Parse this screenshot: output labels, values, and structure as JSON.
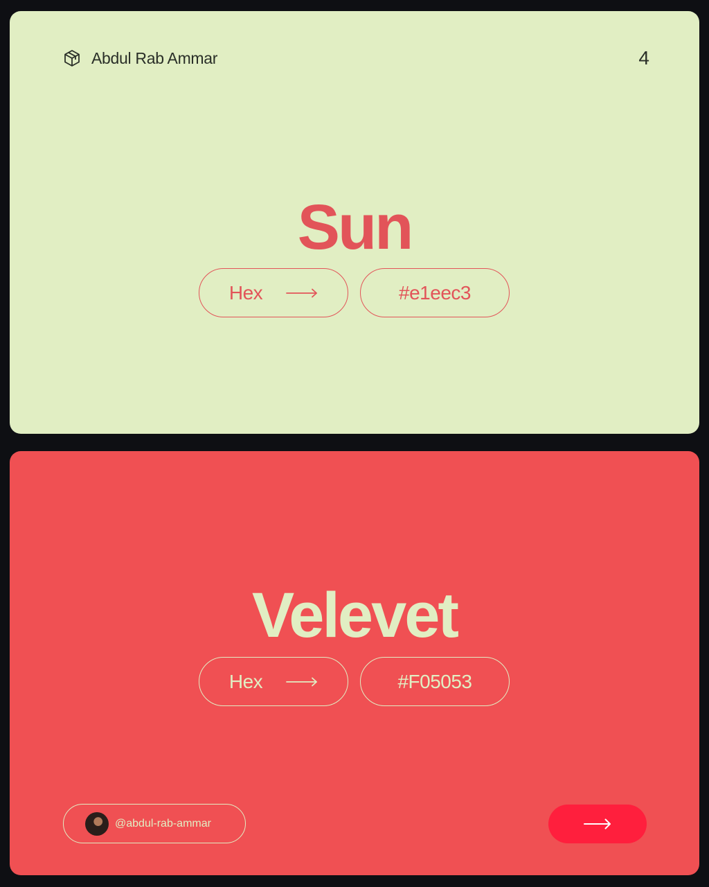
{
  "brand": {
    "name": "Abdul Rab Ammar",
    "icon": "cube-icon"
  },
  "page_number": "4",
  "colors": {
    "primary_bg": "#e1eec3",
    "secondary_bg": "#f05053",
    "button": "#ff1f3d"
  },
  "cards": [
    {
      "name": "Sun",
      "hex_label": "Hex",
      "hex_value": "#e1eec3"
    },
    {
      "name": "Velevet",
      "hex_label": "Hex",
      "hex_value": "#F05053"
    }
  ],
  "footer": {
    "handle": "@abdul-rab-ammar",
    "next_icon": "arrow-right-icon"
  }
}
